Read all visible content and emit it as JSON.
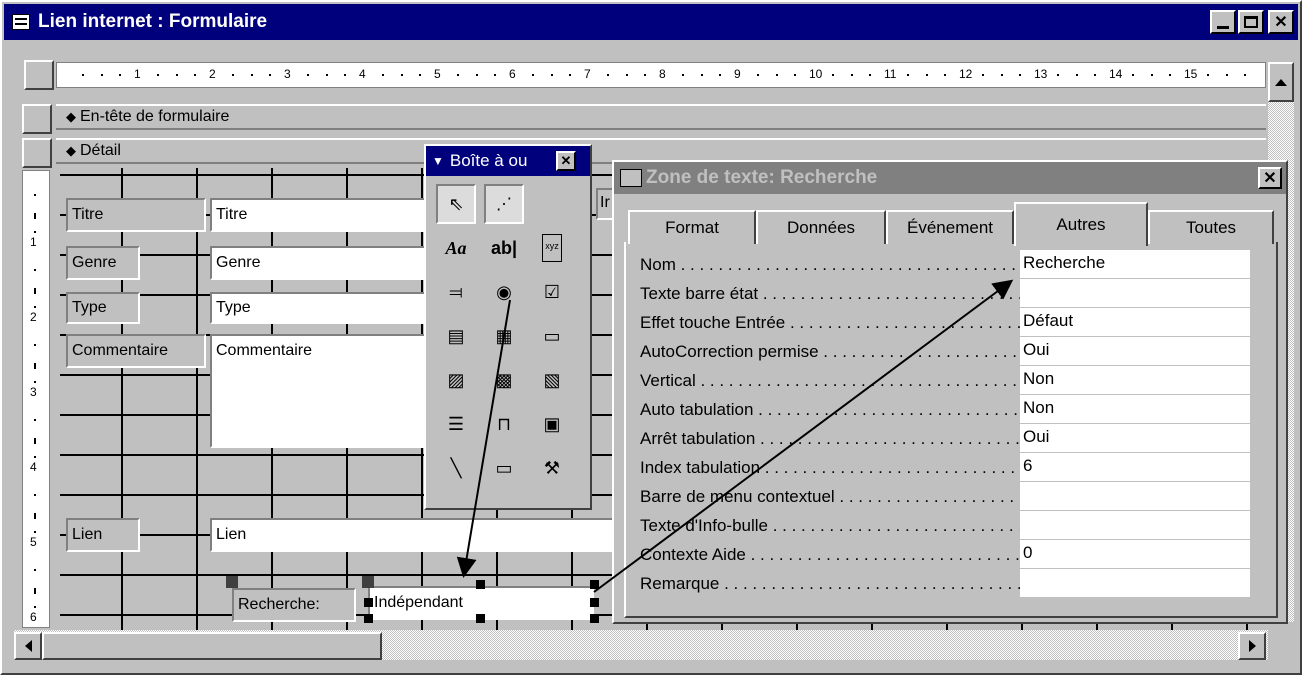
{
  "window": {
    "title": "Lien internet : Formulaire",
    "icon": "form-icon"
  },
  "ruler": {
    "labels": [
      "1",
      "2",
      "3",
      "4",
      "5",
      "6",
      "7",
      "8",
      "9",
      "10",
      "11",
      "12",
      "13",
      "14",
      "15"
    ]
  },
  "vruler": {
    "labels": [
      "1",
      "2",
      "3",
      "4",
      "5",
      "6"
    ]
  },
  "sections": {
    "header": "En-tête de formulaire",
    "detail": "Détail"
  },
  "form": {
    "titre_label": "Titre",
    "titre_field": "Titre",
    "genre_label": "Genre",
    "genre_field": "Genre",
    "type_label": "Type",
    "type_field": "Type",
    "commentaire_label": "Commentaire",
    "commentaire_field": "Commentaire",
    "lien_label": "Lien",
    "lien_field": "Lien",
    "recherche_label": "Recherche:",
    "recherche_field": "Indépendant",
    "partial_label": "Ir"
  },
  "toolbox": {
    "title": "Boîte à ou",
    "tools": [
      "pointer-icon",
      "wizard-icon",
      "label-tool-icon",
      "textbox-tool-icon",
      "option-group-icon",
      "toggle-button-icon",
      "option-button-icon",
      "checkbox-icon",
      "combobox-icon",
      "listbox-icon",
      "command-button-icon",
      "image-icon",
      "unbound-object-icon",
      "bound-object-icon",
      "page-break-icon",
      "tab-control-icon",
      "subform-icon",
      "line-icon",
      "rectangle-icon",
      "more-controls-icon"
    ],
    "text_label_glyph": "Aa",
    "text_box_glyph": "ab|",
    "group_glyph": "xyz"
  },
  "properties": {
    "title": "Zone de texte: Recherche",
    "tabs": [
      "Format",
      "Données",
      "Événement",
      "Autres",
      "Toutes"
    ],
    "active_tab": "Autres",
    "rows": [
      {
        "name": "Nom",
        "value": "Recherche"
      },
      {
        "name": "Texte barre état",
        "value": ""
      },
      {
        "name": "Effet touche Entrée",
        "value": "Défaut"
      },
      {
        "name": "AutoCorrection permise",
        "value": "Oui"
      },
      {
        "name": "Vertical",
        "value": "Non"
      },
      {
        "name": "Auto tabulation",
        "value": "Non"
      },
      {
        "name": "Arrêt tabulation",
        "value": "Oui"
      },
      {
        "name": "Index tabulation",
        "value": "6"
      },
      {
        "name": "Barre de menu contextuel",
        "value": ""
      },
      {
        "name": "Texte d'Info-bulle",
        "value": ""
      },
      {
        "name": "Contexte Aide",
        "value": "0"
      },
      {
        "name": "Remarque",
        "value": ""
      }
    ]
  },
  "colors": {
    "titlebar_active": "#00007c",
    "titlebar_inactive": "#808080",
    "face": "#c0c0c0"
  }
}
